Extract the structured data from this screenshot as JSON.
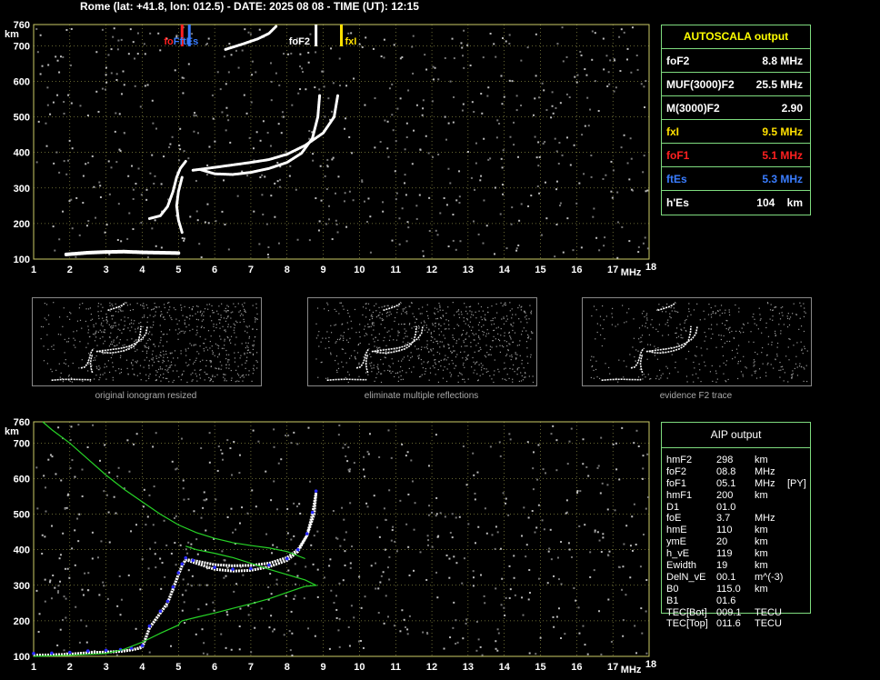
{
  "header": {
    "title": "Rome (lat: +41.8, lon: 012.5) - DATE: 2025 08 08 - TIME (UT): 12:15"
  },
  "colors": {
    "background": "#000000",
    "panel_border": "#7fdc7f",
    "grid": "#cccc66",
    "trace": "#ffffff",
    "foF2": "#ffffff",
    "fxI": "#ffe000",
    "foF1": "#ff2020",
    "ftEs": "#3a7dff",
    "profile": "#27d427",
    "aip_points": "#2a2aff"
  },
  "autoscala": {
    "title": "AUTOSCALA output",
    "rows": [
      {
        "param": "foF2",
        "value": "8.8 MHz",
        "color": "#ffffff"
      },
      {
        "param": "MUF(3000)F2",
        "value": "25.5 MHz",
        "color": "#ffffff"
      },
      {
        "param": "M(3000)F2",
        "value": "2.90",
        "color": "#ffffff"
      },
      {
        "param": "fxI",
        "value": "9.5 MHz",
        "color": "#ffe000"
      },
      {
        "param": "foF1",
        "value": "5.1 MHz",
        "color": "#ff2020"
      },
      {
        "param": "ftEs",
        "value": "5.3 MHz",
        "color": "#3a7dff"
      },
      {
        "param": "h'Es",
        "value": "104    km",
        "color": "#ffffff"
      }
    ]
  },
  "aip": {
    "title": "AIP output",
    "rows": [
      {
        "p": "hmF2",
        "v": "298",
        "u": "km",
        "x": ""
      },
      {
        "p": "foF2",
        "v": "08.8",
        "u": "MHz",
        "x": ""
      },
      {
        "p": "foF1",
        "v": "05.1",
        "u": "MHz",
        "x": "[PY]"
      },
      {
        "p": "hmF1",
        "v": "200",
        "u": "km",
        "x": ""
      },
      {
        "p": "D1",
        "v": "01.0",
        "u": "",
        "x": ""
      },
      {
        "p": "foE",
        "v": "3.7",
        "u": "MHz",
        "x": ""
      },
      {
        "p": "hmE",
        "v": "110",
        "u": "km",
        "x": ""
      },
      {
        "p": "ymE",
        "v": "20",
        "u": "km",
        "x": ""
      },
      {
        "p": "h_vE",
        "v": "119",
        "u": "km",
        "x": ""
      },
      {
        "p": "Ewidth",
        "v": "19",
        "u": "km",
        "x": ""
      },
      {
        "p": "DelN_vE",
        "v": "00.1",
        "u": "m^(-3)",
        "x": ""
      },
      {
        "p": "B0",
        "v": "115.0",
        "u": "km",
        "x": ""
      },
      {
        "p": "B1",
        "v": "01.6",
        "u": "",
        "x": ""
      },
      {
        "p": "TEC[Bot]",
        "v": "009.1",
        "u": "TECU",
        "x": ""
      },
      {
        "p": "TEC[Top]",
        "v": "011.6",
        "u": "TECU",
        "x": ""
      }
    ]
  },
  "thumbnails": [
    {
      "caption": "original ionogram resized"
    },
    {
      "caption": "eliminate multiple reflections"
    },
    {
      "caption": "evidence F2 trace"
    }
  ],
  "chart_data": [
    {
      "type": "scatter",
      "title": "",
      "xlabel": "MHz",
      "ylabel": "km",
      "xlim": [
        1,
        18
      ],
      "ylim": [
        100,
        760
      ],
      "x_ticks": [
        1,
        2,
        3,
        4,
        5,
        6,
        7,
        8,
        9,
        10,
        11,
        12,
        13,
        14,
        15,
        16,
        17,
        18
      ],
      "y_ticks": [
        100,
        200,
        300,
        400,
        500,
        600,
        700,
        760
      ],
      "grid": true,
      "markers": [
        {
          "label": "foF1",
          "freq": 5.1,
          "color": "#ff2020"
        },
        {
          "label": "ftEs",
          "freq": 5.3,
          "color": "#3a7dff"
        },
        {
          "label": "foF2",
          "freq": 8.8,
          "color": "#ffffff"
        },
        {
          "label": "fxI",
          "freq": 9.5,
          "color": "#ffe000"
        }
      ],
      "marker_labels": [
        {
          "text": "fo",
          "color": "#ff2020"
        },
        {
          "text": "F",
          "color": "#3a7dff"
        },
        {
          "text": "ftEs",
          "color": "#3a7dff"
        },
        {
          "text": "foF2",
          "color": "#ffffff"
        },
        {
          "text": "fxI",
          "color": "#ffe000"
        }
      ],
      "series": [
        {
          "values": [
            [
              1.9,
              113
            ],
            [
              2.5,
              118
            ],
            [
              3.0,
              120
            ],
            [
              3.5,
              121
            ],
            [
              4.0,
              119
            ],
            [
              4.5,
              118
            ],
            [
              5.0,
              117
            ]
          ]
        },
        {
          "values": [
            [
              4.2,
              214
            ],
            [
              4.5,
              222
            ],
            [
              4.7,
              248
            ],
            [
              4.85,
              290
            ],
            [
              4.95,
              330
            ],
            [
              5.05,
              355
            ],
            [
              5.2,
              375
            ]
          ]
        },
        {
          "values": [
            [
              5.6,
              352
            ],
            [
              6.0,
              340
            ],
            [
              6.5,
              338
            ],
            [
              7.0,
              344
            ],
            [
              7.5,
              355
            ],
            [
              8.0,
              372
            ],
            [
              8.4,
              398
            ],
            [
              8.7,
              440
            ],
            [
              8.85,
              500
            ],
            [
              8.9,
              560
            ]
          ]
        },
        {
          "values": [
            [
              5.4,
              350
            ],
            [
              6.0,
              358
            ],
            [
              6.5,
              365
            ],
            [
              7.0,
              372
            ],
            [
              7.5,
              380
            ],
            [
              8.0,
              395
            ],
            [
              8.5,
              420
            ],
            [
              9.0,
              455
            ],
            [
              9.3,
              500
            ],
            [
              9.4,
              560
            ]
          ]
        },
        {
          "values": [
            [
              5.1,
              175
            ],
            [
              5.0,
              210
            ],
            [
              4.95,
              250
            ],
            [
              5.0,
              290
            ],
            [
              5.1,
              330
            ]
          ]
        },
        {
          "values": [
            [
              6.3,
              690
            ],
            [
              6.8,
              706
            ],
            [
              7.2,
              720
            ],
            [
              7.5,
              735
            ],
            [
              7.7,
              755
            ]
          ]
        }
      ]
    },
    {
      "type": "scatter",
      "title": "",
      "xlabel": "MHz",
      "ylabel": "km",
      "xlim": [
        1,
        18
      ],
      "ylim": [
        100,
        760
      ],
      "x_ticks": [
        1,
        2,
        3,
        4,
        5,
        6,
        7,
        8,
        9,
        10,
        11,
        12,
        13,
        14,
        15,
        16,
        17,
        18
      ],
      "y_ticks": [
        100,
        200,
        300,
        400,
        500,
        600,
        700,
        760
      ],
      "grid": true,
      "series": [
        {
          "values": [
            [
              1.0,
              103
            ],
            [
              1.5,
              104
            ],
            [
              2.0,
              106
            ],
            [
              2.5,
              110
            ],
            [
              3.0,
              112
            ],
            [
              3.4,
              114
            ],
            [
              3.7,
              118
            ],
            [
              4.0,
              125
            ],
            [
              4.2,
              180
            ],
            [
              4.5,
              222
            ],
            [
              4.7,
              250
            ],
            [
              4.85,
              290
            ],
            [
              5.0,
              330
            ],
            [
              5.1,
              355
            ],
            [
              5.2,
              372
            ],
            [
              5.4,
              370
            ],
            [
              6.0,
              358
            ],
            [
              6.5,
              355
            ],
            [
              7.0,
              356
            ],
            [
              7.5,
              362
            ],
            [
              8.0,
              378
            ],
            [
              8.3,
              400
            ],
            [
              8.55,
              440
            ],
            [
              8.75,
              500
            ],
            [
              8.8,
              560
            ]
          ]
        },
        {
          "values": [
            [
              1.0,
              103
            ],
            [
              1.5,
              104
            ],
            [
              2.0,
              106
            ],
            [
              2.5,
              110
            ],
            [
              3.0,
              112
            ],
            [
              3.4,
              114
            ],
            [
              3.7,
              118
            ],
            [
              4.0,
              125
            ],
            [
              4.2,
              180
            ],
            [
              4.5,
              222
            ],
            [
              4.7,
              250
            ],
            [
              4.85,
              290
            ],
            [
              5.0,
              330
            ],
            [
              5.1,
              355
            ],
            [
              5.2,
              372
            ],
            [
              5.4,
              365
            ],
            [
              6.0,
              345
            ],
            [
              6.5,
              340
            ],
            [
              7.0,
              342
            ],
            [
              7.5,
              352
            ],
            [
              8.0,
              370
            ],
            [
              8.3,
              395
            ],
            [
              8.55,
              440
            ],
            [
              8.7,
              500
            ],
            [
              8.8,
              560
            ]
          ]
        },
        {
          "values": [
            [
              1.0,
              103
            ],
            [
              1.5,
              104
            ],
            [
              2.0,
              106
            ],
            [
              2.5,
              110
            ],
            [
              3.0,
              112
            ],
            [
              3.4,
              114
            ],
            [
              3.7,
              118
            ],
            [
              4.0,
              125
            ],
            [
              4.2,
              180
            ],
            [
              4.5,
              222
            ],
            [
              4.7,
              250
            ],
            [
              4.85,
              290
            ],
            [
              5.0,
              330
            ],
            [
              5.1,
              355
            ],
            [
              5.2,
              372
            ],
            [
              5.4,
              365
            ],
            [
              6.0,
              345
            ],
            [
              6.5,
              340
            ],
            [
              7.0,
              342
            ],
            [
              7.5,
              352
            ],
            [
              8.0,
              370
            ],
            [
              8.3,
              395
            ],
            [
              8.55,
              440
            ],
            [
              8.7,
              500
            ],
            [
              8.8,
              560
            ]
          ]
        },
        {
          "values": [
            [
              1.25,
              760
            ],
            [
              1.5,
              738
            ],
            [
              2.0,
              700
            ],
            [
              2.5,
              655
            ],
            [
              3.0,
              610
            ],
            [
              3.5,
              570
            ],
            [
              4.0,
              535
            ],
            [
              4.5,
              500
            ],
            [
              5.0,
              470
            ],
            [
              5.5,
              448
            ],
            [
              6.0,
              432
            ],
            [
              6.5,
              420
            ],
            [
              7.0,
              412
            ],
            [
              7.5,
              405
            ],
            [
              8.0,
              395
            ],
            [
              8.5,
              375
            ]
          ]
        },
        {
          "values": [
            [
              1.0,
              100
            ],
            [
              2.0,
              103
            ],
            [
              3.0,
              108
            ],
            [
              3.5,
              120
            ],
            [
              4.0,
              140
            ],
            [
              4.5,
              165
            ],
            [
              5.0,
              188
            ],
            [
              5.05,
              196
            ],
            [
              5.1,
              200
            ],
            [
              5.5,
              210
            ],
            [
              6.0,
              222
            ],
            [
              6.5,
              235
            ],
            [
              7.0,
              248
            ],
            [
              7.5,
              262
            ],
            [
              8.0,
              280
            ],
            [
              8.5,
              297
            ],
            [
              8.8,
              300
            ],
            [
              8.5,
              315
            ],
            [
              8.0,
              330
            ],
            [
              7.5,
              345
            ],
            [
              7.0,
              362
            ],
            [
              6.5,
              378
            ],
            [
              6.0,
              390
            ],
            [
              5.5,
              400
            ],
            [
              5.2,
              410
            ]
          ]
        }
      ]
    }
  ]
}
